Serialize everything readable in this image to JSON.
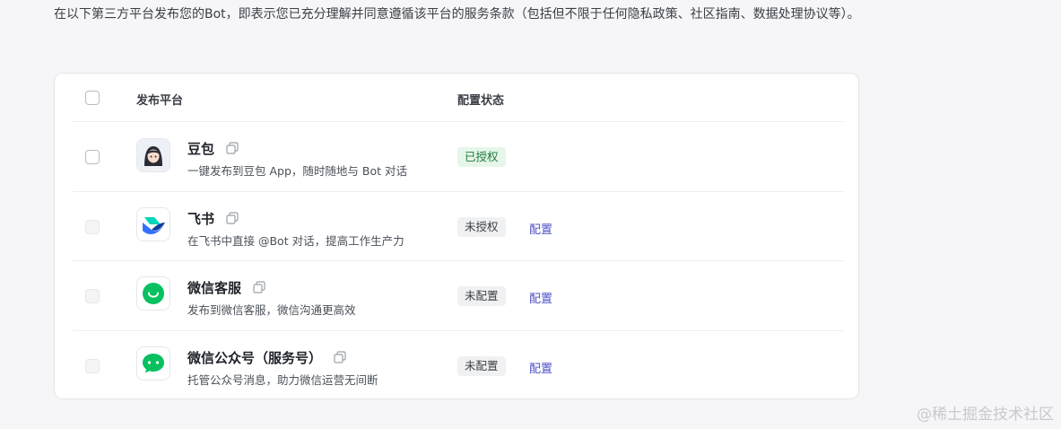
{
  "notice": "在以下第三方平台发布您的Bot，即表示您已充分理解并同意遵循该平台的服务条款（包括但不限于任何隐私政策、社区指南、数据处理协议等）。",
  "table": {
    "col_platform": "发布平台",
    "col_status": "配置状态",
    "rows": [
      {
        "name": "豆包",
        "desc": "一键发布到豆包 App，随时随地与 Bot 对话",
        "status": "已授权",
        "action": "",
        "icon": "doubao-avatar-icon",
        "checkbox_disabled": false
      },
      {
        "name": "飞书",
        "desc": "在飞书中直接 @Bot 对话，提高工作生产力",
        "status": "未授权",
        "action": "配置",
        "icon": "feishu-logo-icon",
        "checkbox_disabled": true
      },
      {
        "name": "微信客服",
        "desc": "发布到微信客服，微信沟通更高效",
        "status": "未配置",
        "action": "配置",
        "icon": "wechat-service-icon",
        "checkbox_disabled": true
      },
      {
        "name": "微信公众号（服务号）",
        "desc": "托管公众号消息，助力微信运营无间断",
        "status": "未配置",
        "action": "配置",
        "icon": "wechat-official-icon",
        "checkbox_disabled": true
      }
    ]
  },
  "colors": {
    "accent": "#4e4fc6",
    "authorized_bg": "#e6f6ea",
    "authorized_text": "#1f7a3a",
    "wechat_green": "#07c160"
  },
  "watermark": "@稀土掘金技术社区"
}
